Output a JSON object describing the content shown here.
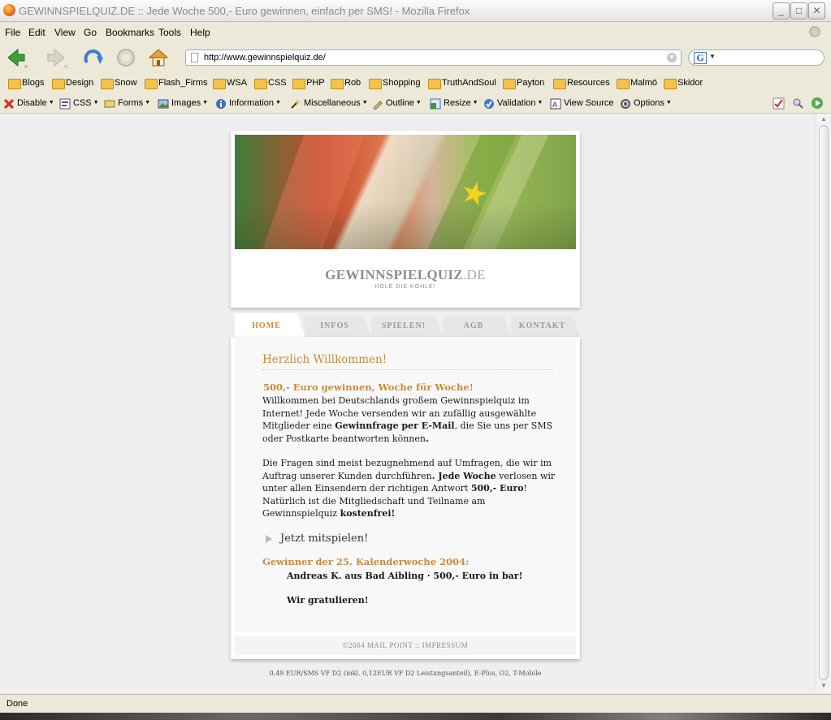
{
  "window": {
    "title": "GEWINNSPIELQUIZ.DE :: Jede Woche 500,- Euro gewinnen, einfach per SMS! - Mozilla Firefox",
    "minimize": "_",
    "maximize": "□",
    "close": "✕"
  },
  "menu": [
    "File",
    "Edit",
    "View",
    "Go",
    "Bookmarks",
    "Tools",
    "Help"
  ],
  "navigation": {
    "url": "http://www.gewinnspielquiz.de/",
    "search_engine": "G"
  },
  "bookmarks": [
    "Blogs",
    "Design",
    "Snow",
    "Flash_Firms",
    "WSA",
    "CSS",
    "PHP",
    "Rob",
    "Shopping",
    "TruthAndSoul",
    "Payton",
    "Resources",
    "Malmö",
    "Skidor"
  ],
  "devtoolbar": [
    "Disable",
    "CSS",
    "Forms",
    "Images",
    "Information",
    "Miscellaneous",
    "Outline",
    "Resize",
    "Validation",
    "View Source",
    "Options"
  ],
  "site": {
    "logo_main": "GEWINNSPIELQUIZ",
    "logo_tld": ".DE",
    "slogan": "HOLE DIE KOHLE!",
    "tabs": [
      "HOME",
      "INFOS",
      "SPIELEN!",
      "AGB",
      "KONTAKT"
    ],
    "active_tab": "HOME",
    "welcome": "Herzlich Willkommen!",
    "subheading": "500,- Euro gewinnen, Woche für Woche!",
    "para1": {
      "a": "Willkommen bei Deutschlands großem Gewinnspielquiz im Internet! Jede Woche versenden wir an zufällig ausgewählte Mitglieder eine ",
      "b": "Gewinnfrage per E-Mail",
      "c": ", die Sie uns per SMS oder Postkarte beantworten können",
      "d": "."
    },
    "para2": {
      "a": "Die Fragen sind meist bezugnehmend auf Umfragen, die wir im Auftrag unserer Kunden durchführen",
      "b": ". Jede Woche",
      "c": " verlosen wir unter allen Einsendern der richtigen Antwort ",
      "d": "500,- Euro",
      "e": "! Natürlich ist die Mitgliedschaft und Teilname am Gewinnspielquiz ",
      "f": "kostenfrei!"
    },
    "cta": "Jetzt mitspielen!",
    "winner_heading": "Gewinner der 25. Kalenderwoche 2004:",
    "winner": "Andreas K. aus Bad Aibling · 500,- Euro in bar!",
    "congrats": "Wir gratulieren!",
    "footer": "©2004 MAIL POINT :: IMPRESSUM",
    "note": "0,49 EUR/SMS VF D2 (inkl. 0,12EUR VF D2 Leistungsanteil), E-Plus, O2, T-Mobile"
  },
  "status": "Done"
}
